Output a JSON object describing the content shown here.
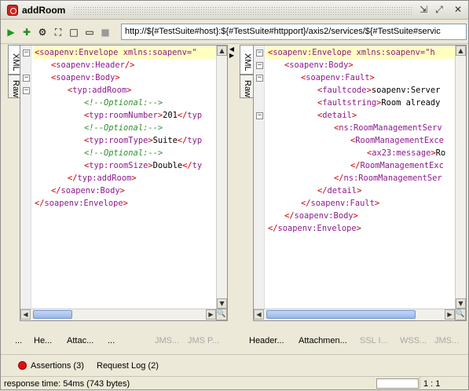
{
  "window": {
    "title": "addRoom",
    "controls": [
      "restore-icon",
      "maximize-icon",
      "close-icon"
    ]
  },
  "toolbar": {
    "icons": [
      "run-icon",
      "add-assertion-icon",
      "options-icon",
      "maximize-pane-icon",
      "split-view-icon",
      "split-view-horizontal-icon",
      "stop-icon"
    ],
    "endpoint": "http://${#TestSuite#host}:${#TestSuite#httpport}/axis2/services/${#TestSuite#servic"
  },
  "request": {
    "tabs": [
      "XML",
      "Raw"
    ],
    "lines": [
      {
        "indent": 0,
        "parts": [
          {
            "c": "br",
            "t": "<"
          },
          {
            "c": "tag",
            "t": "soapenv:Envelope xmlns:soapenv=\""
          },
          {
            "c": "br",
            "t": ""
          }
        ],
        "highlight": true
      },
      {
        "indent": 1,
        "parts": [
          {
            "c": "br",
            "t": "<"
          },
          {
            "c": "tag",
            "t": "soapenv:Header"
          },
          {
            "c": "br",
            "t": "/>"
          }
        ]
      },
      {
        "indent": 1,
        "parts": [
          {
            "c": "br",
            "t": "<"
          },
          {
            "c": "tag",
            "t": "soapenv:Body"
          },
          {
            "c": "br",
            "t": ">"
          }
        ]
      },
      {
        "indent": 2,
        "parts": [
          {
            "c": "br",
            "t": "<"
          },
          {
            "c": "tag",
            "t": "typ:addRoom"
          },
          {
            "c": "br",
            "t": ">"
          }
        ]
      },
      {
        "indent": 3,
        "parts": [
          {
            "c": "cm",
            "t": "<!--Optional:-->"
          }
        ]
      },
      {
        "indent": 3,
        "parts": [
          {
            "c": "br",
            "t": "<"
          },
          {
            "c": "tag",
            "t": "typ:roomNumber"
          },
          {
            "c": "br",
            "t": ">"
          },
          {
            "c": "tx",
            "t": "201"
          },
          {
            "c": "br",
            "t": "</"
          },
          {
            "c": "tag",
            "t": "typ"
          }
        ]
      },
      {
        "indent": 3,
        "parts": [
          {
            "c": "cm",
            "t": "<!--Optional:-->"
          }
        ]
      },
      {
        "indent": 3,
        "parts": [
          {
            "c": "br",
            "t": "<"
          },
          {
            "c": "tag",
            "t": "typ:roomType"
          },
          {
            "c": "br",
            "t": ">"
          },
          {
            "c": "tx",
            "t": "Suite"
          },
          {
            "c": "br",
            "t": "</"
          },
          {
            "c": "tag",
            "t": "typ"
          }
        ]
      },
      {
        "indent": 3,
        "parts": [
          {
            "c": "cm",
            "t": "<!--Optional:-->"
          }
        ]
      },
      {
        "indent": 3,
        "parts": [
          {
            "c": "br",
            "t": "<"
          },
          {
            "c": "tag",
            "t": "typ:roomSize"
          },
          {
            "c": "br",
            "t": ">"
          },
          {
            "c": "tx",
            "t": "Double"
          },
          {
            "c": "br",
            "t": "</"
          },
          {
            "c": "tag",
            "t": "ty"
          }
        ]
      },
      {
        "indent": 2,
        "parts": [
          {
            "c": "br",
            "t": "</"
          },
          {
            "c": "tag",
            "t": "typ:addRoom"
          },
          {
            "c": "br",
            "t": ">"
          }
        ]
      },
      {
        "indent": 1,
        "parts": [
          {
            "c": "br",
            "t": "</"
          },
          {
            "c": "tag",
            "t": "soapenv:Body"
          },
          {
            "c": "br",
            "t": ">"
          }
        ]
      },
      {
        "indent": 0,
        "parts": [
          {
            "c": "br",
            "t": "</"
          },
          {
            "c": "tag",
            "t": "soapenv:Envelope"
          },
          {
            "c": "br",
            "t": ">"
          }
        ]
      }
    ],
    "folds": [
      0,
      2,
      3
    ],
    "bottom_tabs": [
      {
        "label": "...",
        "dim": false
      },
      {
        "label": "He...",
        "dim": false
      },
      {
        "label": "Attac...",
        "dim": false
      },
      {
        "label": "...",
        "dim": false
      },
      {
        "label": "JMS...",
        "dim": true
      },
      {
        "label": "JMS P...",
        "dim": true
      }
    ]
  },
  "response": {
    "tabs": [
      "XML",
      "Raw"
    ],
    "lines": [
      {
        "indent": 0,
        "parts": [
          {
            "c": "br",
            "t": "<"
          },
          {
            "c": "tag",
            "t": "soapenv:Envelope xmlns:soapenv=\"h"
          }
        ],
        "highlight": true
      },
      {
        "indent": 1,
        "parts": [
          {
            "c": "br",
            "t": "<"
          },
          {
            "c": "tag",
            "t": "soapenv:Body"
          },
          {
            "c": "br",
            "t": ">"
          }
        ]
      },
      {
        "indent": 2,
        "parts": [
          {
            "c": "br",
            "t": "<"
          },
          {
            "c": "tag",
            "t": "soapenv:Fault"
          },
          {
            "c": "br",
            "t": ">"
          }
        ]
      },
      {
        "indent": 3,
        "parts": [
          {
            "c": "br",
            "t": "<"
          },
          {
            "c": "tag",
            "t": "faultcode"
          },
          {
            "c": "br",
            "t": ">"
          },
          {
            "c": "tx",
            "t": "soapenv:Server"
          }
        ]
      },
      {
        "indent": 3,
        "parts": [
          {
            "c": "br",
            "t": "<"
          },
          {
            "c": "tag",
            "t": "faultstring"
          },
          {
            "c": "br",
            "t": ">"
          },
          {
            "c": "tx",
            "t": "Room already"
          }
        ]
      },
      {
        "indent": 3,
        "parts": [
          {
            "c": "br",
            "t": "<"
          },
          {
            "c": "tag",
            "t": "detail"
          },
          {
            "c": "br",
            "t": ">"
          }
        ]
      },
      {
        "indent": 4,
        "parts": [
          {
            "c": "br",
            "t": "<"
          },
          {
            "c": "tag",
            "t": "ns:RoomManagementServ"
          }
        ]
      },
      {
        "indent": 5,
        "parts": [
          {
            "c": "br",
            "t": "<"
          },
          {
            "c": "tag",
            "t": "RoomManagementExce"
          }
        ]
      },
      {
        "indent": 6,
        "parts": [
          {
            "c": "br",
            "t": "<"
          },
          {
            "c": "tag",
            "t": "ax23:message"
          },
          {
            "c": "br",
            "t": ">"
          },
          {
            "c": "tx",
            "t": "Ro"
          }
        ]
      },
      {
        "indent": 5,
        "parts": [
          {
            "c": "br",
            "t": "</"
          },
          {
            "c": "tag",
            "t": "RoomManagementExc"
          }
        ]
      },
      {
        "indent": 4,
        "parts": [
          {
            "c": "br",
            "t": "</"
          },
          {
            "c": "tag",
            "t": "ns:RoomManagementSer"
          }
        ]
      },
      {
        "indent": 3,
        "parts": [
          {
            "c": "br",
            "t": "</"
          },
          {
            "c": "tag",
            "t": "detail"
          },
          {
            "c": "br",
            "t": ">"
          }
        ]
      },
      {
        "indent": 2,
        "parts": [
          {
            "c": "br",
            "t": "</"
          },
          {
            "c": "tag",
            "t": "soapenv:Fault"
          },
          {
            "c": "br",
            "t": ">"
          }
        ]
      },
      {
        "indent": 1,
        "parts": [
          {
            "c": "br",
            "t": "</"
          },
          {
            "c": "tag",
            "t": "soapenv:Body"
          },
          {
            "c": "br",
            "t": ">"
          }
        ]
      },
      {
        "indent": 0,
        "parts": [
          {
            "c": "br",
            "t": "</"
          },
          {
            "c": "tag",
            "t": "soapenv:Envelope"
          },
          {
            "c": "br",
            "t": ">"
          }
        ]
      }
    ],
    "folds": [
      0,
      1,
      2,
      5
    ],
    "bottom_tabs": [
      {
        "label": "Header...",
        "dim": false
      },
      {
        "label": "Attachmen...",
        "dim": false
      },
      {
        "label": "SSL I...",
        "dim": true
      },
      {
        "label": "WSS...",
        "dim": true
      },
      {
        "label": "JMS...",
        "dim": true
      }
    ]
  },
  "assertions": {
    "assertions_label": "Assertions (3)",
    "request_log_label": "Request Log (2)"
  },
  "status": {
    "response_time": "response time: 54ms (743 bytes)",
    "position": "1 : 1"
  },
  "colors": {
    "tag": "#8b1a8b",
    "bracket": "#c80000",
    "comment": "#2f8f2f",
    "highlight": "#ffffc0",
    "assert_fail": "#e01010"
  }
}
